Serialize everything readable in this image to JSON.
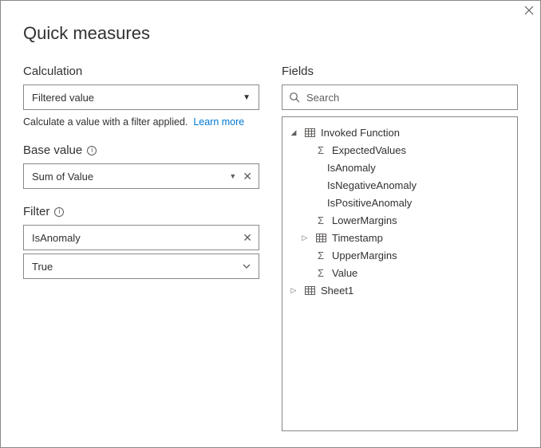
{
  "dialog": {
    "title": "Quick measures"
  },
  "calculation": {
    "label": "Calculation",
    "selected": "Filtered value",
    "description": "Calculate a value with a filter applied.",
    "learn_more": "Learn more"
  },
  "base_value": {
    "label": "Base value",
    "value": "Sum of Value"
  },
  "filter": {
    "label": "Filter",
    "field": "IsAnomaly",
    "value": "True"
  },
  "fields": {
    "label": "Fields",
    "search_placeholder": "Search"
  },
  "tree": {
    "root1": "Invoked Function",
    "items1": {
      "a": "ExpectedValues",
      "b": "IsAnomaly",
      "c": "IsNegativeAnomaly",
      "d": "IsPositiveAnomaly",
      "e": "LowerMargins",
      "f": "Timestamp",
      "g": "UpperMargins",
      "h": "Value"
    },
    "root2": "Sheet1"
  }
}
